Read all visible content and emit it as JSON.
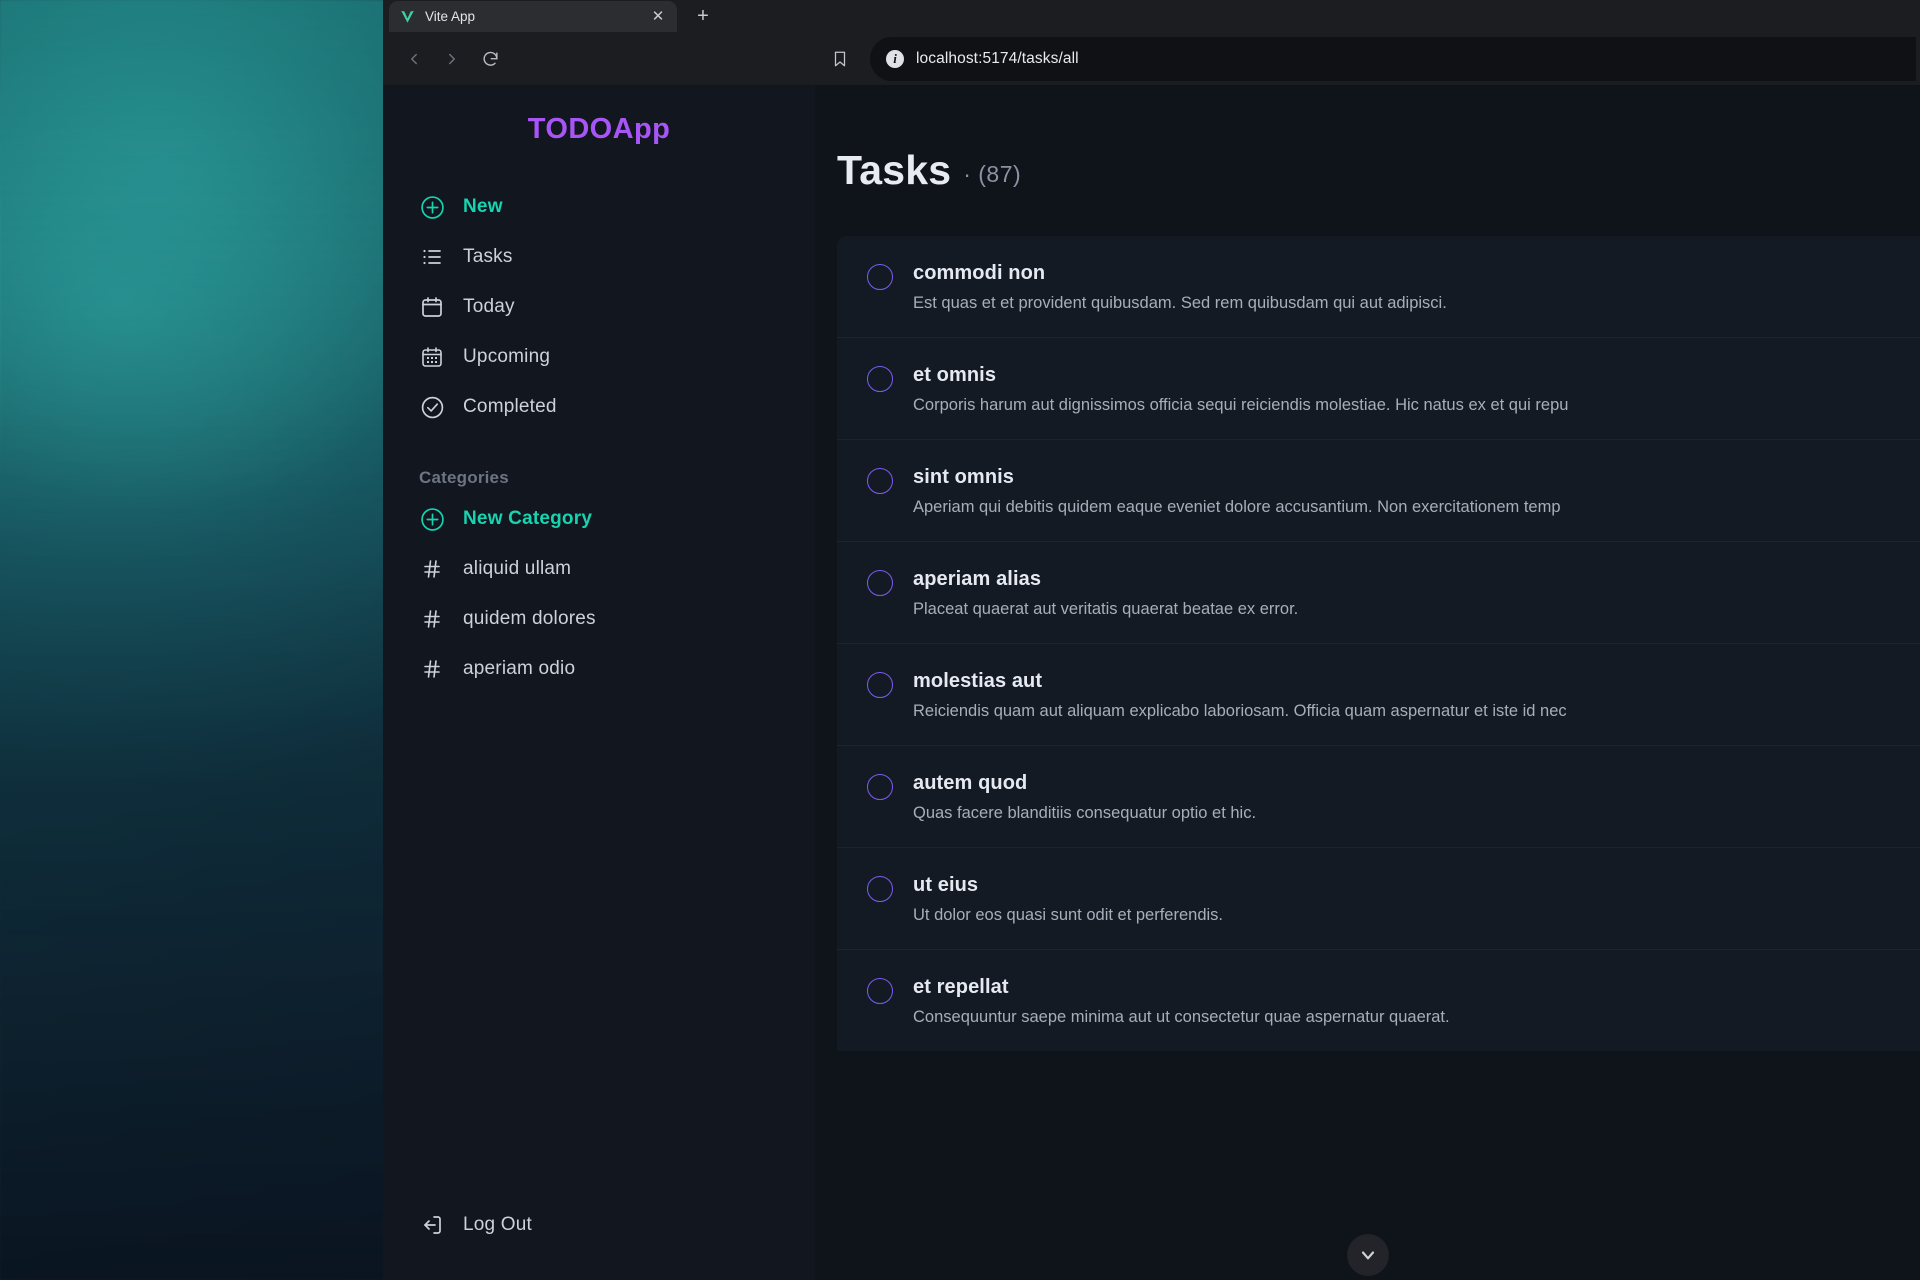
{
  "browser": {
    "tab": {
      "title": "Vite App",
      "favicon_icon": "vite-logo-icon",
      "close_icon": "close-icon"
    },
    "new_tab_label": "+",
    "back_icon": "chevron-left-icon",
    "forward_icon": "chevron-right-icon",
    "reload_icon": "reload-icon",
    "bookmark_icon": "bookmark-icon",
    "site_info_icon": "info-icon",
    "url": "localhost:5174/tasks/all"
  },
  "sidebar": {
    "brand": "TODOApp",
    "nav": [
      {
        "label": "New",
        "icon": "plus-circle-icon",
        "accent": true
      },
      {
        "label": "Tasks",
        "icon": "list-icon",
        "accent": false
      },
      {
        "label": "Today",
        "icon": "calendar-icon",
        "accent": false
      },
      {
        "label": "Upcoming",
        "icon": "calendar-days-icon",
        "accent": false
      },
      {
        "label": "Completed",
        "icon": "check-circle-icon",
        "accent": false
      }
    ],
    "categories_heading": "Categories",
    "new_category": {
      "label": "New Category",
      "icon": "plus-circle-icon"
    },
    "categories": [
      {
        "label": "aliquid ullam",
        "icon": "hash-icon"
      },
      {
        "label": "quidem dolores",
        "icon": "hash-icon"
      },
      {
        "label": "aperiam odio",
        "icon": "hash-icon"
      }
    ],
    "logout": {
      "label": "Log Out",
      "icon": "logout-icon"
    }
  },
  "main": {
    "title": "Tasks",
    "count_label": "· (87)",
    "scroll_down_icon": "chevron-down-icon",
    "tasks": [
      {
        "title": "commodi non",
        "desc": "Est quas et et provident quibusdam. Sed rem quibusdam qui aut adipisci."
      },
      {
        "title": "et omnis",
        "desc": "Corporis harum aut dignissimos officia sequi reiciendis molestiae. Hic natus ex et qui repu"
      },
      {
        "title": "sint omnis",
        "desc": "Aperiam qui debitis quidem eaque eveniet dolore accusantium. Non exercitationem temp"
      },
      {
        "title": "aperiam alias",
        "desc": "Placeat quaerat aut veritatis quaerat beatae ex error."
      },
      {
        "title": "molestias aut",
        "desc": "Reiciendis quam aut aliquam explicabo laboriosam. Officia quam aspernatur et iste id nec"
      },
      {
        "title": "autem quod",
        "desc": "Quas facere blanditiis consequatur optio et hic."
      },
      {
        "title": "ut eius",
        "desc": "Ut dolor eos quasi sunt odit et perferendis."
      },
      {
        "title": "et repellat",
        "desc": "Consequuntur saepe minima aut ut consectetur quae aspernatur quaerat."
      }
    ]
  },
  "colors": {
    "brand_purple": "#a855f7",
    "accent_teal": "#17d3b0",
    "checkbox_purple": "#7c5cf0",
    "page_bg": "#0f131a",
    "sidebar_bg": "#11161f",
    "card_bg": "#141a24"
  }
}
